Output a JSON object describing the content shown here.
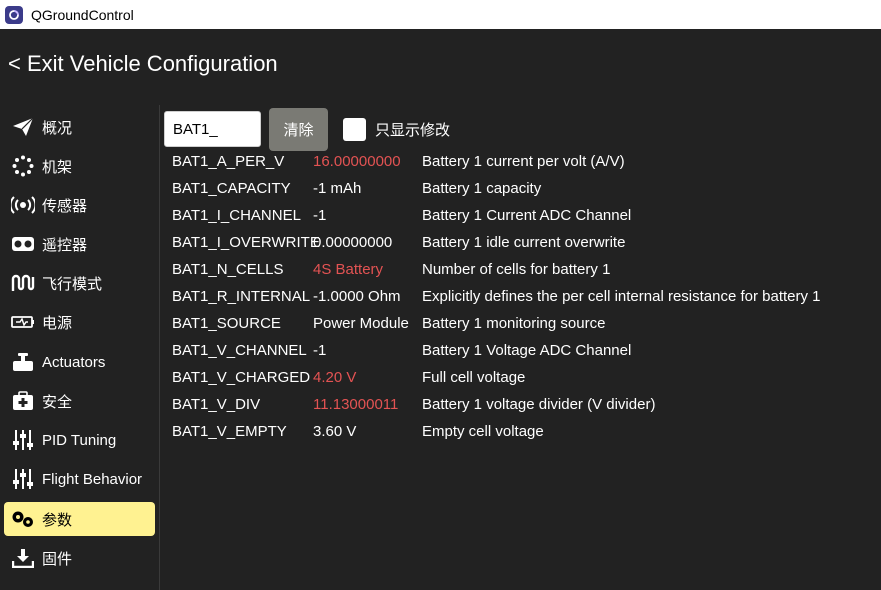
{
  "window": {
    "title": "QGroundControl"
  },
  "header": {
    "exit_label": "< Exit Vehicle Configuration"
  },
  "sidebar": {
    "items": [
      {
        "label": "概况",
        "icon": "paper-plane-icon",
        "active": false
      },
      {
        "label": "机架",
        "icon": "airframe-dots-icon",
        "active": false
      },
      {
        "label": "传感器",
        "icon": "sensors-radiate-icon",
        "active": false
      },
      {
        "label": "遥控器",
        "icon": "radio-controller-icon",
        "active": false
      },
      {
        "label": "飞行模式",
        "icon": "flight-modes-wave-icon",
        "active": false
      },
      {
        "label": "电源",
        "icon": "power-battery-icon",
        "active": false
      },
      {
        "label": "Actuators",
        "icon": "actuators-icon",
        "active": false
      },
      {
        "label": "安全",
        "icon": "safety-medkit-icon",
        "active": false
      },
      {
        "label": "PID Tuning",
        "icon": "tuning-sliders-icon",
        "active": false
      },
      {
        "label": "Flight Behavior",
        "icon": "behavior-sliders-icon",
        "active": false
      },
      {
        "label": "参数",
        "icon": "parameters-gears-icon",
        "active": true
      },
      {
        "label": "固件",
        "icon": "firmware-download-icon",
        "active": false
      }
    ]
  },
  "toolbar": {
    "search_value": "BAT1_",
    "clear_label": "清除",
    "show_modified_label": "只显示修改",
    "show_modified_checked": false
  },
  "colors": {
    "modified_value": "#e35353",
    "active_item_bg": "#fff291",
    "clear_button_bg": "#7a7a74"
  },
  "params": [
    {
      "name": "BAT1_A_PER_V",
      "value": "16.00000000",
      "desc": "Battery 1 current per volt (A/V)",
      "modified": true
    },
    {
      "name": "BAT1_CAPACITY",
      "value": "-1 mAh",
      "desc": "Battery 1 capacity",
      "modified": false
    },
    {
      "name": "BAT1_I_CHANNEL",
      "value": "-1",
      "desc": "Battery 1 Current ADC Channel",
      "modified": false
    },
    {
      "name": "BAT1_I_OVERWRITE",
      "value": "0.00000000",
      "desc": "Battery 1 idle current overwrite",
      "modified": false
    },
    {
      "name": "BAT1_N_CELLS",
      "value": "4S Battery",
      "desc": "Number of cells for battery 1",
      "modified": true
    },
    {
      "name": "BAT1_R_INTERNAL",
      "value": "-1.0000 Ohm",
      "desc": "Explicitly defines the per cell internal resistance for battery 1",
      "modified": false
    },
    {
      "name": "BAT1_SOURCE",
      "value": "Power Module",
      "desc": "Battery 1 monitoring source",
      "modified": false
    },
    {
      "name": "BAT1_V_CHANNEL",
      "value": "-1",
      "desc": "Battery 1 Voltage ADC Channel",
      "modified": false
    },
    {
      "name": "BAT1_V_CHARGED",
      "value": "4.20 V",
      "desc": "Full cell voltage",
      "modified": true
    },
    {
      "name": "BAT1_V_DIV",
      "value": "11.13000011",
      "desc": "Battery 1 voltage divider (V divider)",
      "modified": true
    },
    {
      "name": "BAT1_V_EMPTY",
      "value": "3.60 V",
      "desc": "Empty cell voltage",
      "modified": false
    }
  ]
}
